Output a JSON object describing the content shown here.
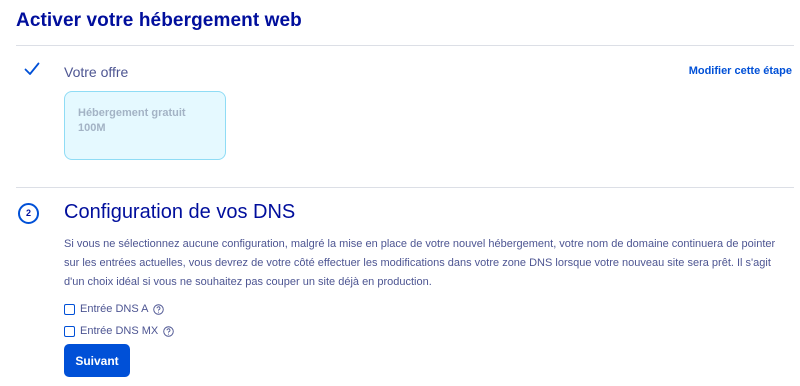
{
  "page": {
    "title": "Activer votre hébergement web"
  },
  "step1": {
    "label": "Votre offre",
    "modify_link": "Modifier cette étape",
    "offer": {
      "name": "Hébergement gratuit",
      "size": "100M"
    }
  },
  "step2": {
    "number": "2",
    "title": "Configuration de vos DNS",
    "description": "Si vous ne sélectionnez aucune configuration, malgré la mise en place de votre nouvel hébergement, votre nom de domaine continuera de pointer sur les entrées actuelles, vous devrez de votre côté effectuer les modifications dans votre zone DNS lorsque votre nouveau site sera prêt. Il s'agit d'un choix idéal si vous ne souhaitez pas couper un site déjà en production.",
    "options": [
      {
        "label": "Entrée DNS A",
        "checked": false,
        "icon": "help-circle-icon"
      },
      {
        "label": "Entrée DNS MX",
        "checked": false,
        "icon": "help-circle-icon"
      }
    ],
    "submit_label": "Suivant"
  },
  "colors": {
    "primary": "#0050d7",
    "heading": "#000e9c",
    "text": "#4d5592",
    "tile_bg": "#e5f9ff",
    "tile_border": "#8fdcf5"
  }
}
